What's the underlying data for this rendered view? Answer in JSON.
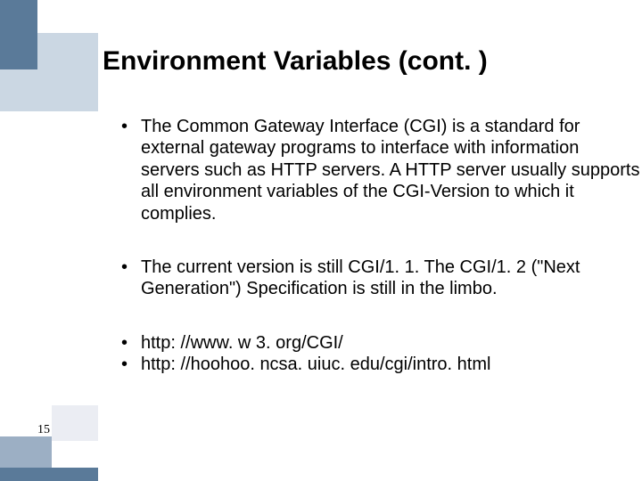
{
  "title": "Environment Variables (cont. )",
  "bullets": {
    "b1": "The Common Gateway Interface (CGI) is a standard for external gateway programs to interface with information servers such as HTTP servers. A HTTP server usually supports all environment variables of the CGI-Version to which it complies.",
    "b2": " The current version is still CGI/1. 1. The CGI/1. 2 (\"Next Generation\") Specification is still in the limbo.",
    "b3": "http: //www. w 3. org/CGI/",
    "b4": "http: //hoohoo. ncsa. uiuc. edu/cgi/intro. html"
  },
  "page_number": "15"
}
